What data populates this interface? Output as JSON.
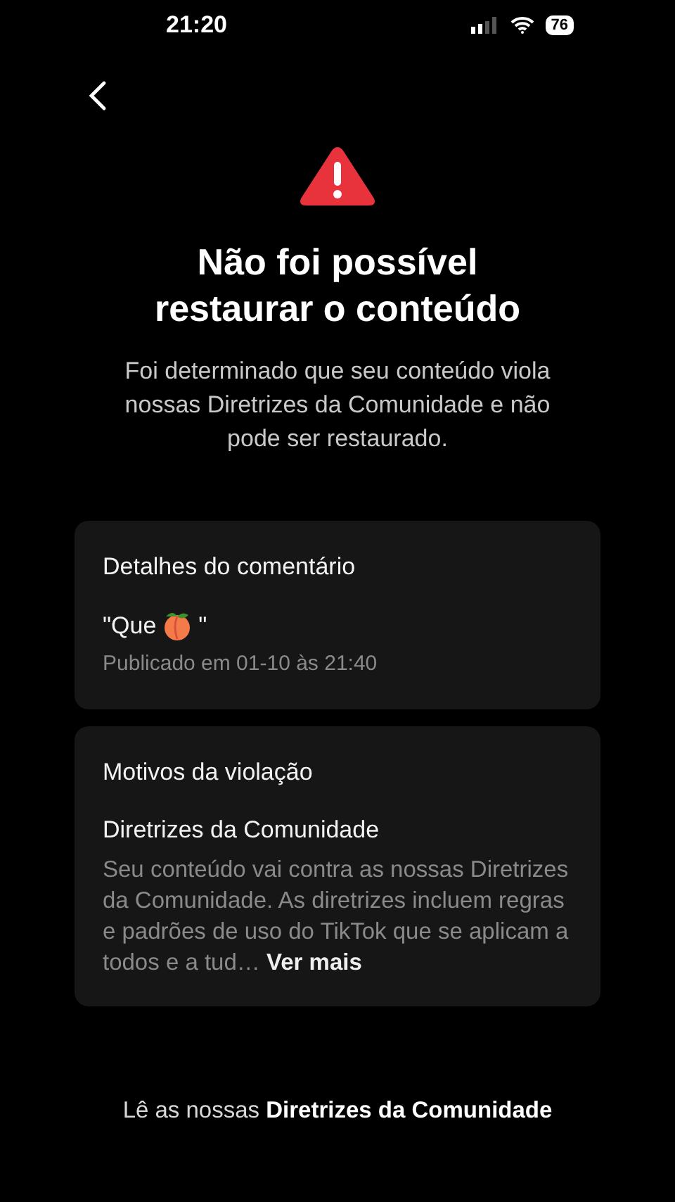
{
  "status_bar": {
    "time": "21:20",
    "battery": "76"
  },
  "title": "Não foi possível restaurar o conteúdo",
  "subtitle": "Foi determinado que seu conteúdo viola nossas Diretrizes da Comunidade e não pode ser restaurado.",
  "comment_card": {
    "heading": "Detalhes do comentário",
    "quote_open": "\"Que",
    "quote_close": "\"",
    "posted": "Publicado em 01-10 às 21:40"
  },
  "violation_card": {
    "heading": "Motivos da violação",
    "policy": "Diretrizes da Comunidade",
    "description": "Seu conteúdo vai contra as nossas Diretrizes da Comunidade. As diretrizes incluem regras e padrões de uso do TikTok que se aplicam a todos e a tud…",
    "more": "Ver mais"
  },
  "footer": "Lê as nossas **Diretrizes da Comunidade**"
}
